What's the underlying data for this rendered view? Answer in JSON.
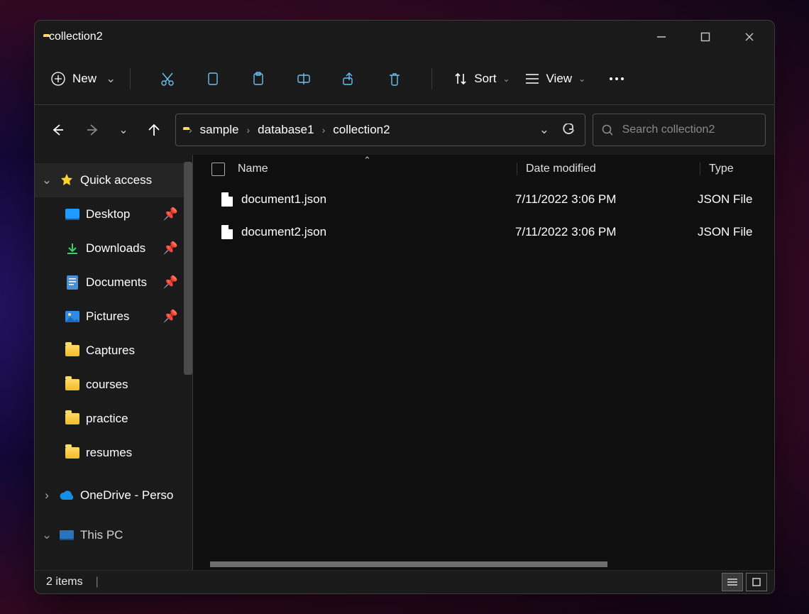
{
  "title": "collection2",
  "toolbar": {
    "new": "New",
    "sort": "Sort",
    "view": "View"
  },
  "breadcrumb": [
    "sample",
    "database1",
    "collection2"
  ],
  "search": {
    "placeholder": "Search collection2"
  },
  "sidebar": {
    "quick": "Quick access",
    "items": [
      {
        "label": "Desktop",
        "pinned": true,
        "icon": "desktop"
      },
      {
        "label": "Downloads",
        "pinned": true,
        "icon": "download"
      },
      {
        "label": "Documents",
        "pinned": true,
        "icon": "doc"
      },
      {
        "label": "Pictures",
        "pinned": true,
        "icon": "pic"
      },
      {
        "label": "Captures",
        "pinned": false,
        "icon": "folder"
      },
      {
        "label": "courses",
        "pinned": false,
        "icon": "folder"
      },
      {
        "label": "practice",
        "pinned": false,
        "icon": "folder"
      },
      {
        "label": "resumes",
        "pinned": false,
        "icon": "folder"
      }
    ],
    "onedrive": "OneDrive - Perso",
    "thispc": "This PC"
  },
  "columns": {
    "name": "Name",
    "date": "Date modified",
    "type": "Type"
  },
  "files": [
    {
      "name": "document1.json",
      "date": "7/11/2022 3:06 PM",
      "type": "JSON File"
    },
    {
      "name": "document2.json",
      "date": "7/11/2022 3:06 PM",
      "type": "JSON File"
    }
  ],
  "status": {
    "count": "2 items"
  }
}
